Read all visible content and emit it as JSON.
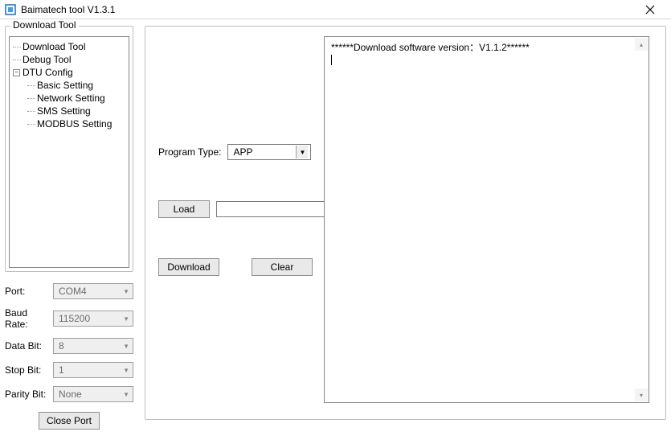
{
  "titlebar": {
    "title": "Baimatech tool V1.3.1"
  },
  "left": {
    "group_title": "Download Tool",
    "tree": {
      "items": [
        "Download Tool",
        "Debug Tool"
      ],
      "dtu": {
        "label": "DTU Config",
        "children": [
          "Basic Setting",
          "Network Setting",
          "SMS Setting",
          "MODBUS Setting"
        ]
      }
    },
    "port_labels": {
      "port": "Port:",
      "baud": "Baud Rate:",
      "data": "Data Bit:",
      "stop": "Stop Bit:",
      "parity": "Parity Bit:"
    },
    "port_values": {
      "port": "COM4",
      "baud": "115200",
      "data": "8",
      "stop": "1",
      "parity": "None"
    },
    "close_port": "Close Port"
  },
  "right": {
    "program_type_label": "Program Type:",
    "program_type_value": "APP",
    "load_btn": "Load",
    "load_path": "",
    "download_btn": "Download",
    "clear_btn": "Clear",
    "log_line1": "******Download software version：V1.1.2******"
  }
}
